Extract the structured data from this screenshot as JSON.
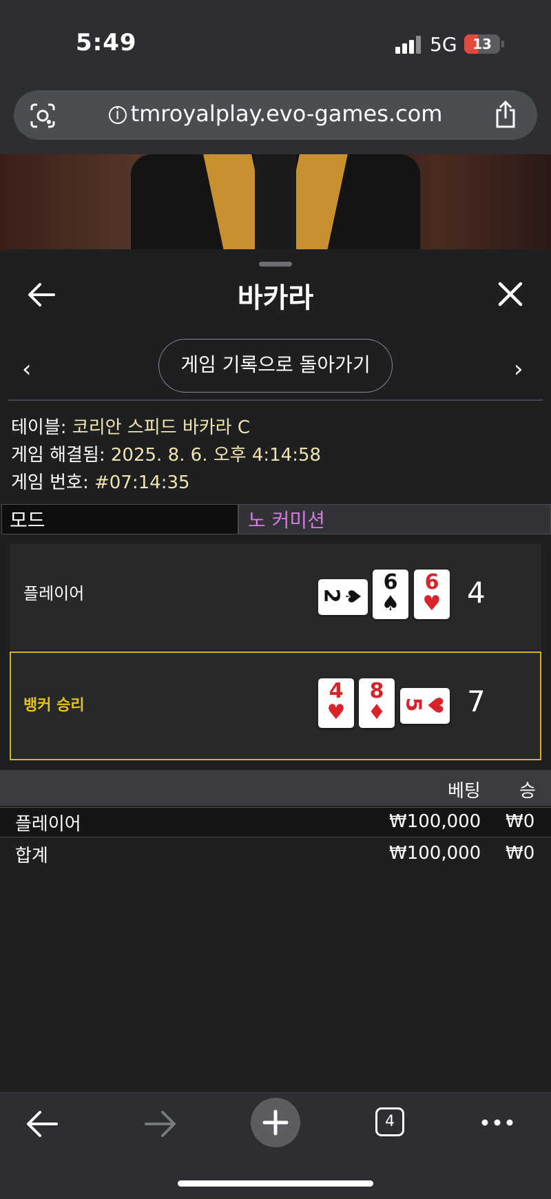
{
  "status_bar": {
    "time": "5:49",
    "network": "5G",
    "battery": "13"
  },
  "browser": {
    "url": "tmroyalplay.evo-games.com",
    "tab_count": "4"
  },
  "panel": {
    "title": "바카라",
    "return_button": "게임 기록으로 돌아가기",
    "info": {
      "table_label": "테이블: ",
      "table_value": "코리안 스피드 바카라 C",
      "resolved_label": "게임 해결됨: ",
      "resolved_value": "2025. 8. 6. 오후 4:14:58",
      "number_label": "게임 번호: ",
      "number_value": "#07:14:35"
    },
    "mode": {
      "label": "모드",
      "value": "노 커미션"
    },
    "hands": {
      "player": {
        "label": "플레이어",
        "score": "4",
        "cards": [
          {
            "rank": "2",
            "suit": "♠",
            "color": "black",
            "sideways": true
          },
          {
            "rank": "6",
            "suit": "♠",
            "color": "black",
            "sideways": false
          },
          {
            "rank": "6",
            "suit": "♥",
            "color": "red",
            "sideways": false
          }
        ]
      },
      "banker": {
        "label": "뱅커 승리",
        "score": "7",
        "cards": [
          {
            "rank": "4",
            "suit": "♥",
            "color": "red",
            "sideways": false
          },
          {
            "rank": "8",
            "suit": "♦",
            "color": "red",
            "sideways": false
          },
          {
            "rank": "5",
            "suit": "♥",
            "color": "red",
            "sideways": true
          }
        ]
      }
    },
    "table": {
      "headers": {
        "bet": "베팅",
        "win": "승"
      },
      "rows": [
        {
          "name": "플레이어",
          "bet": "₩100,000",
          "win": "₩0"
        },
        {
          "name": "합계",
          "bet": "₩100,000",
          "win": "₩0"
        }
      ]
    }
  },
  "colors": {
    "accent_gold": "#d9b41a",
    "mode_purple": "#d67ae0",
    "info_value": "#f2e4b0"
  }
}
